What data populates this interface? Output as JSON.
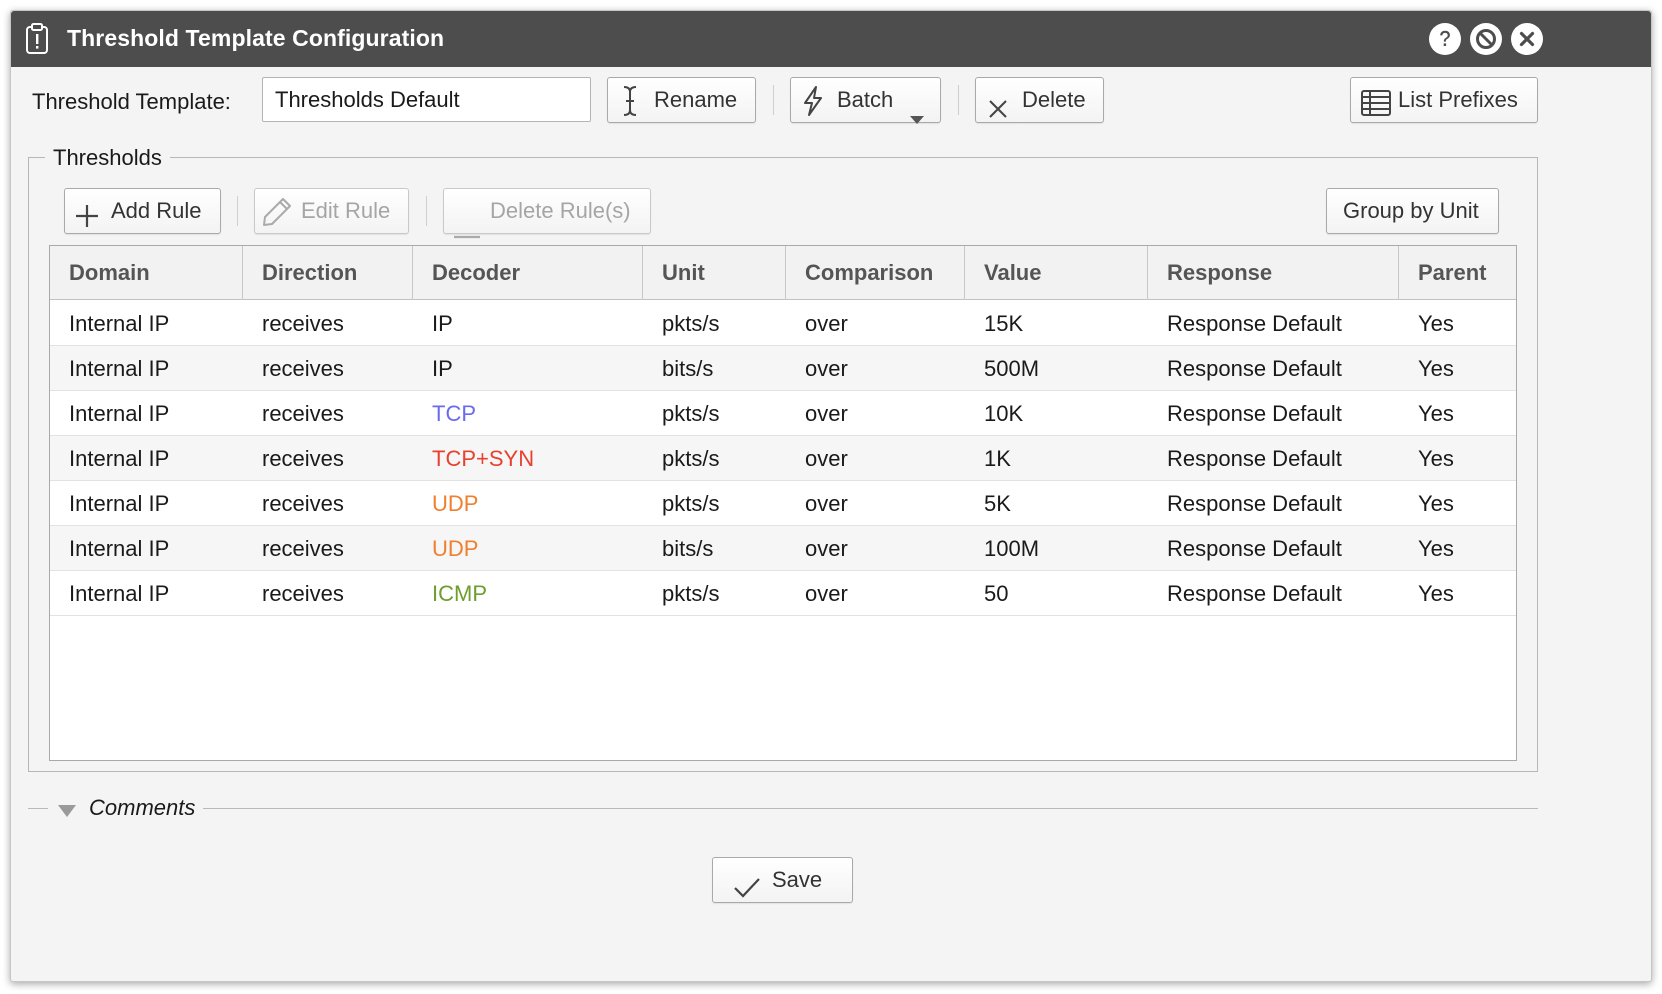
{
  "window": {
    "title": "Threshold Template Configuration",
    "title_icons": [
      "clipboard-alert-icon"
    ],
    "controls": [
      "help-icon",
      "block-icon",
      "close-icon"
    ]
  },
  "toolbar": {
    "template_label": "Threshold Template:",
    "template_value": "Thresholds Default",
    "rename_label": "Rename",
    "batch_label": "Batch",
    "delete_label": "Delete",
    "list_prefixes_label": "List Prefixes"
  },
  "thresholds": {
    "legend": "Thresholds",
    "add_rule_label": "Add Rule",
    "edit_rule_label": "Edit Rule",
    "delete_rules_label": "Delete Rule(s)",
    "group_by_unit_label": "Group by Unit",
    "columns": [
      "Domain",
      "Direction",
      "Decoder",
      "Unit",
      "Comparison",
      "Value",
      "Response",
      "Parent"
    ],
    "rows": [
      {
        "domain": "Internal IP",
        "direction": "receives",
        "decoder": "IP",
        "decoder_color": "#1a1a1a",
        "unit": "pkts/s",
        "comparison": "over",
        "value": "15K",
        "response": "Response Default",
        "parent": "Yes"
      },
      {
        "domain": "Internal IP",
        "direction": "receives",
        "decoder": "IP",
        "decoder_color": "#1a1a1a",
        "unit": "bits/s",
        "comparison": "over",
        "value": "500M",
        "response": "Response Default",
        "parent": "Yes"
      },
      {
        "domain": "Internal IP",
        "direction": "receives",
        "decoder": "TCP",
        "decoder_color": "#6a6af0",
        "unit": "pkts/s",
        "comparison": "over",
        "value": "10K",
        "response": "Response Default",
        "parent": "Yes"
      },
      {
        "domain": "Internal IP",
        "direction": "receives",
        "decoder": "TCP+SYN",
        "decoder_color": "#e8412f",
        "unit": "pkts/s",
        "comparison": "over",
        "value": "1K",
        "response": "Response Default",
        "parent": "Yes"
      },
      {
        "domain": "Internal IP",
        "direction": "receives",
        "decoder": "UDP",
        "decoder_color": "#f07f2e",
        "unit": "pkts/s",
        "comparison": "over",
        "value": "5K",
        "response": "Response Default",
        "parent": "Yes"
      },
      {
        "domain": "Internal IP",
        "direction": "receives",
        "decoder": "UDP",
        "decoder_color": "#f07f2e",
        "unit": "bits/s",
        "comparison": "over",
        "value": "100M",
        "response": "Response Default",
        "parent": "Yes"
      },
      {
        "domain": "Internal IP",
        "direction": "receives",
        "decoder": "ICMP",
        "decoder_color": "#6f9e2c",
        "unit": "pkts/s",
        "comparison": "over",
        "value": "50",
        "response": "Response Default",
        "parent": "Yes"
      }
    ]
  },
  "comments": {
    "label": "Comments"
  },
  "footer": {
    "save_label": "Save"
  }
}
